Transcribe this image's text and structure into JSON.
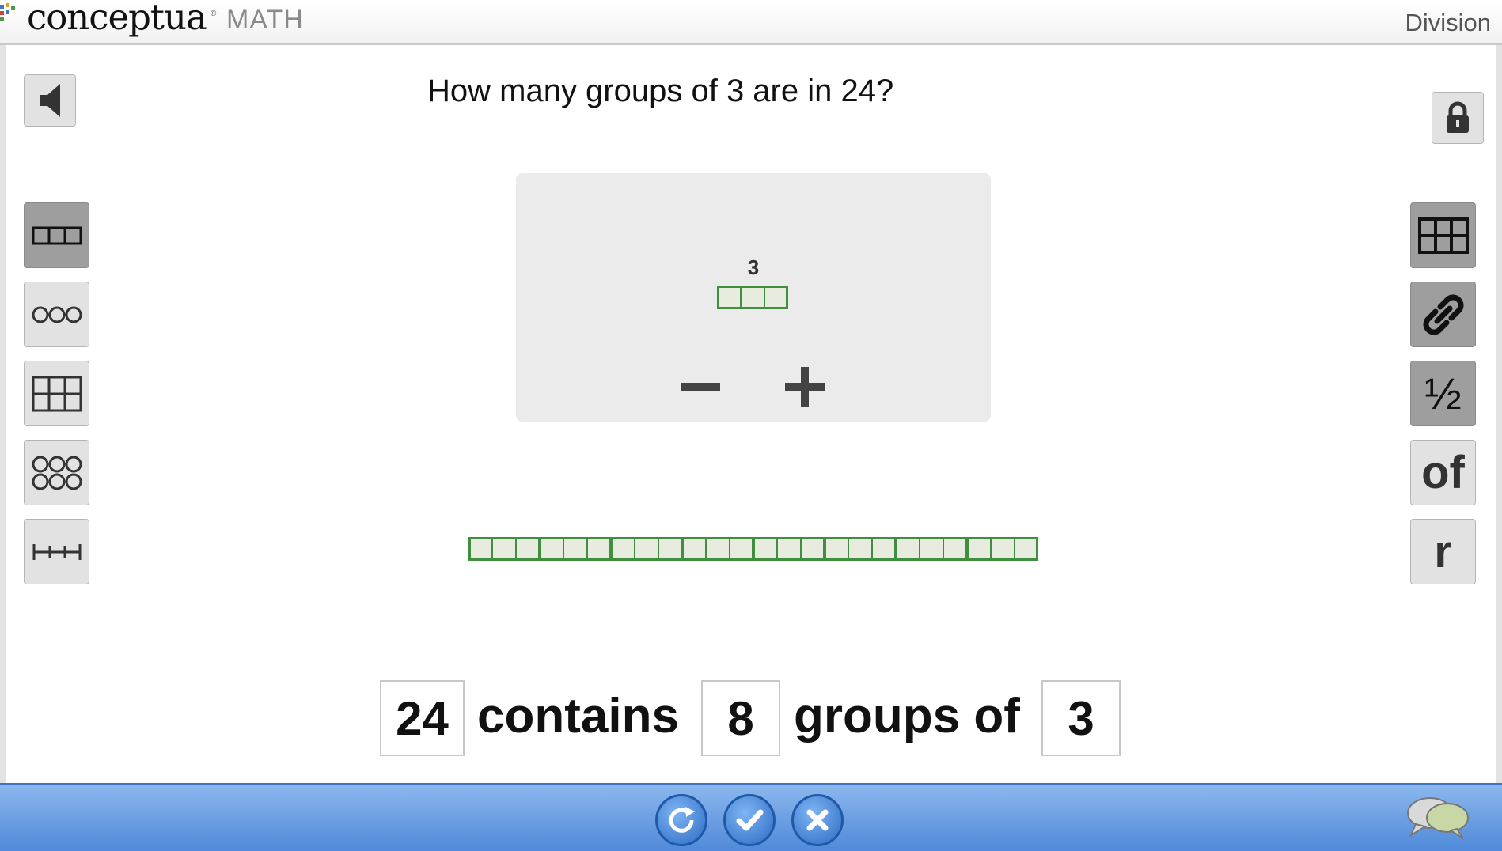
{
  "header": {
    "logo_text": "conceptua",
    "logo_reg": "®",
    "logo_math": "MATH",
    "title": "Division"
  },
  "question": "How many groups of 3 are in 24?",
  "workspace": {
    "group_size_label": "3",
    "group_size": 3,
    "total_units": 24,
    "group_count": 8
  },
  "sentence": {
    "total": "24",
    "word1": "contains",
    "groups": "8",
    "word2": "groups of",
    "size": "3"
  },
  "left_tools": [
    "bar-model-icon",
    "circles-icon",
    "grid-icon",
    "circle-array-icon",
    "number-line-icon"
  ],
  "right_tools": [
    "table-icon",
    "link-icon",
    "fraction-icon",
    "of-icon",
    "remainder-icon"
  ],
  "right_labels": {
    "fraction": "½",
    "of": "of",
    "remainder": "r"
  },
  "colors": {
    "bar_stroke": "#3f8f3f",
    "bar_fill": "#e7ecdf",
    "footer_blue": "#5a92dc"
  }
}
